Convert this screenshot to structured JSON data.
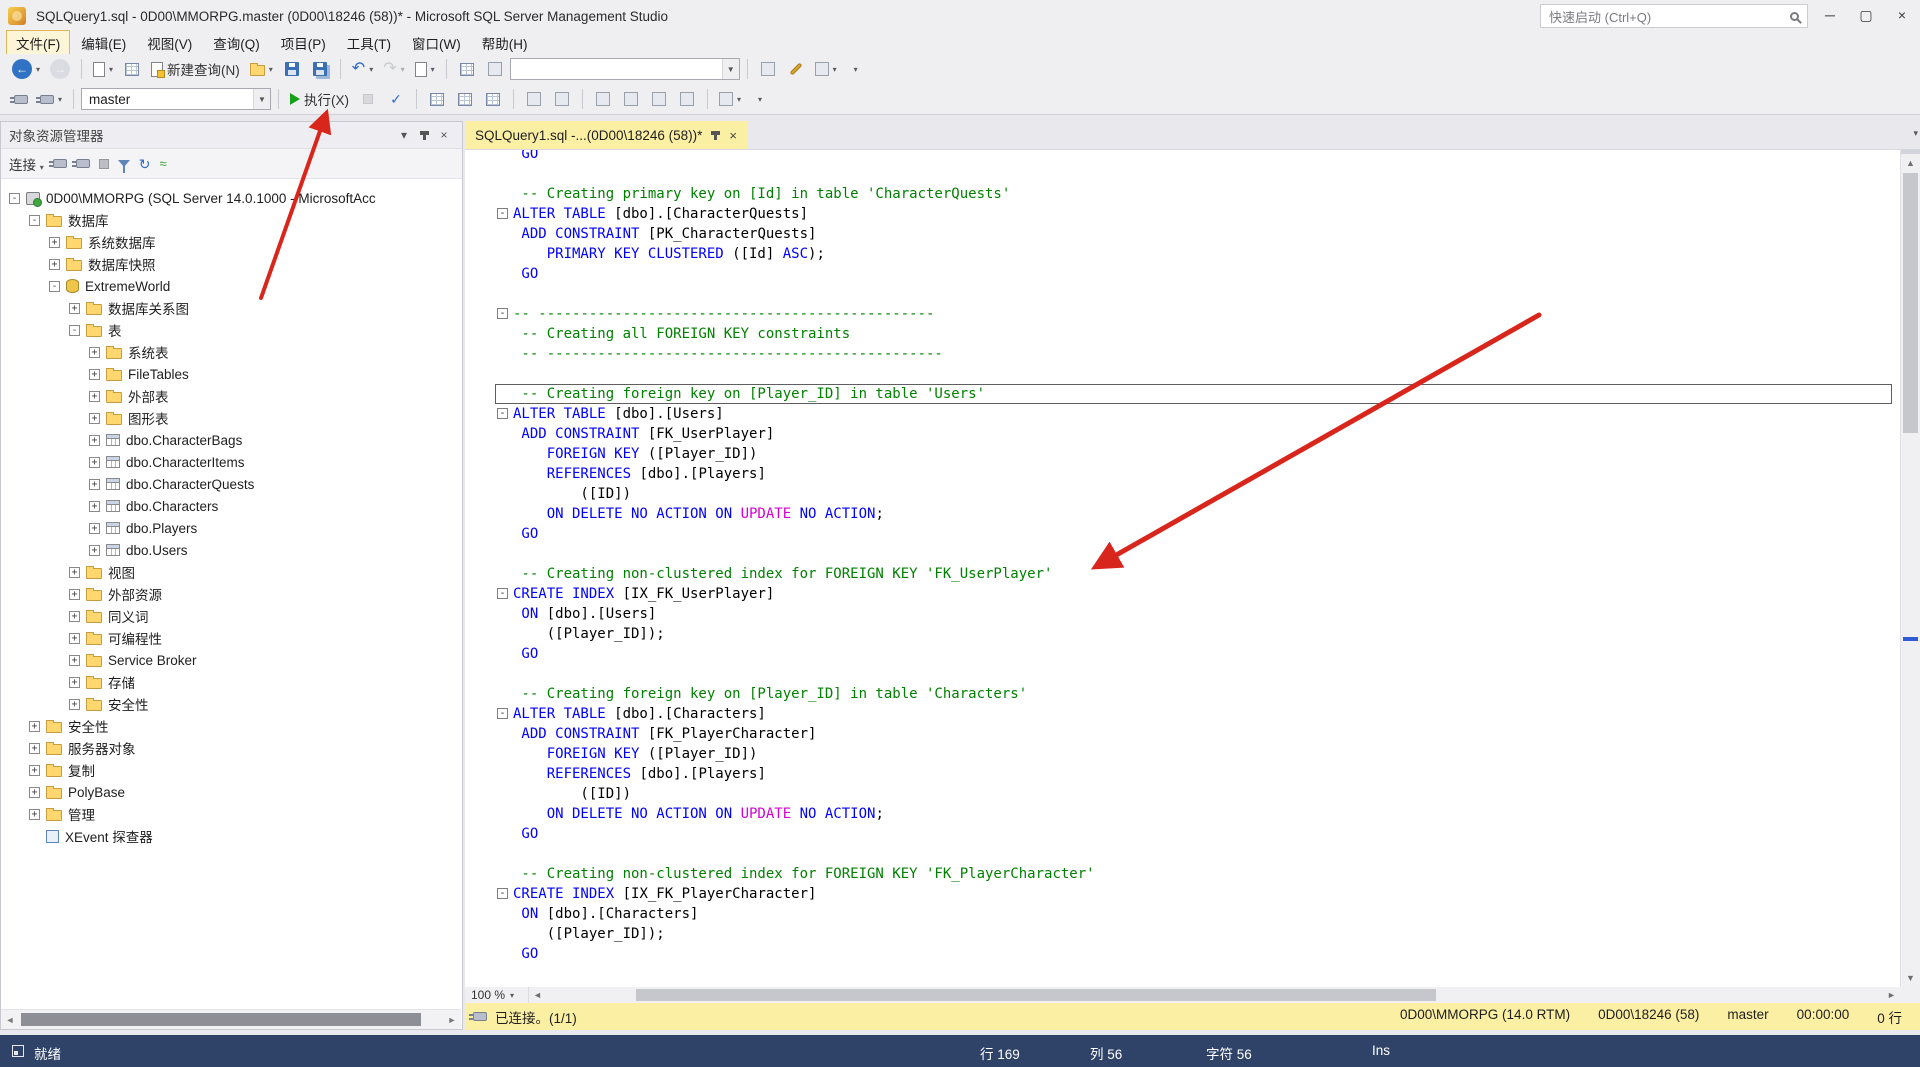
{
  "window": {
    "title": "SQLQuery1.sql - 0D00\\MMORPG.master (0D00\\18246 (58))* - Microsoft SQL Server Management Studio",
    "quick_launch": "快速启动 (Ctrl+Q)"
  },
  "menu": {
    "items": [
      "文件(F)",
      "编辑(E)",
      "视图(V)",
      "查询(Q)",
      "项目(P)",
      "工具(T)",
      "窗口(W)",
      "帮助(H)"
    ]
  },
  "toolbar": {
    "new_query_label": "新建查询(N)",
    "database_value": "master",
    "execute_label": "执行(X)"
  },
  "object_explorer": {
    "title": "对象资源管理器",
    "connect_label": "连接",
    "tree": [
      {
        "indent": 0,
        "exp": "collapse",
        "icon": "server",
        "label": "0D00\\MMORPG (SQL Server 14.0.1000 - MicrosoftAcc"
      },
      {
        "indent": 1,
        "exp": "collapse",
        "icon": "folder",
        "label": "数据库"
      },
      {
        "indent": 2,
        "exp": "expand",
        "icon": "folder",
        "label": "系统数据库"
      },
      {
        "indent": 2,
        "exp": "expand",
        "icon": "folder",
        "label": "数据库快照"
      },
      {
        "indent": 2,
        "exp": "collapse",
        "icon": "database",
        "label": "ExtremeWorld"
      },
      {
        "indent": 3,
        "exp": "expand",
        "icon": "folder",
        "label": "数据库关系图"
      },
      {
        "indent": 3,
        "exp": "collapse",
        "icon": "folder",
        "label": "表"
      },
      {
        "indent": 4,
        "exp": "expand",
        "icon": "folder",
        "label": "系统表"
      },
      {
        "indent": 4,
        "exp": "expand",
        "icon": "folder",
        "label": "FileTables"
      },
      {
        "indent": 4,
        "exp": "expand",
        "icon": "folder",
        "label": "外部表"
      },
      {
        "indent": 4,
        "exp": "expand",
        "icon": "folder",
        "label": "图形表"
      },
      {
        "indent": 4,
        "exp": "expand",
        "icon": "table",
        "label": "dbo.CharacterBags"
      },
      {
        "indent": 4,
        "exp": "expand",
        "icon": "table",
        "label": "dbo.CharacterItems"
      },
      {
        "indent": 4,
        "exp": "expand",
        "icon": "table",
        "label": "dbo.CharacterQuests"
      },
      {
        "indent": 4,
        "exp": "expand",
        "icon": "table",
        "label": "dbo.Characters"
      },
      {
        "indent": 4,
        "exp": "expand",
        "icon": "table",
        "label": "dbo.Players"
      },
      {
        "indent": 4,
        "exp": "expand",
        "icon": "table",
        "label": "dbo.Users"
      },
      {
        "indent": 3,
        "exp": "expand",
        "icon": "folder",
        "label": "视图"
      },
      {
        "indent": 3,
        "exp": "expand",
        "icon": "folder",
        "label": "外部资源"
      },
      {
        "indent": 3,
        "exp": "expand",
        "icon": "folder",
        "label": "同义词"
      },
      {
        "indent": 3,
        "exp": "expand",
        "icon": "folder",
        "label": "可编程性"
      },
      {
        "indent": 3,
        "exp": "expand",
        "icon": "folder",
        "label": "Service Broker"
      },
      {
        "indent": 3,
        "exp": "expand",
        "icon": "folder",
        "label": "存储"
      },
      {
        "indent": 3,
        "exp": "expand",
        "icon": "folder",
        "label": "安全性"
      },
      {
        "indent": 1,
        "exp": "expand",
        "icon": "folder",
        "label": "安全性"
      },
      {
        "indent": 1,
        "exp": "expand",
        "icon": "folder",
        "label": "服务器对象"
      },
      {
        "indent": 1,
        "exp": "expand",
        "icon": "folder",
        "label": "复制"
      },
      {
        "indent": 1,
        "exp": "expand",
        "icon": "folder",
        "label": "PolyBase"
      },
      {
        "indent": 1,
        "exp": "expand",
        "icon": "folder",
        "label": "管理"
      },
      {
        "indent": 1,
        "exp": "none",
        "icon": "xevent",
        "label": "XEvent 探查器"
      }
    ]
  },
  "editor": {
    "tab_title": "SQLQuery1.sql -...(0D00\\18246 (58))*",
    "zoom": "100 %",
    "lines": [
      {
        "s": [
          [
            "k",
            " GO"
          ]
        ]
      },
      {
        "s": []
      },
      {
        "s": [
          [
            "c",
            " -- Creating primary key on [Id] in table 'CharacterQuests'"
          ]
        ]
      },
      {
        "f": true,
        "s": [
          [
            "k",
            "ALTER TABLE"
          ],
          [
            "n",
            " [dbo].[CharacterQuests]"
          ]
        ]
      },
      {
        "s": [
          [
            "k",
            " ADD CONSTRAINT"
          ],
          [
            "n",
            " [PK_CharacterQuests]"
          ]
        ]
      },
      {
        "s": [
          [
            "k",
            "    PRIMARY KEY CLUSTERED"
          ],
          [
            "n",
            " ([Id] "
          ],
          [
            "k",
            "ASC"
          ],
          [
            "n",
            ");"
          ]
        ]
      },
      {
        "s": [
          [
            "k",
            " GO"
          ]
        ]
      },
      {
        "s": []
      },
      {
        "f": true,
        "s": [
          [
            "c",
            "-- -----------------------------------------------"
          ]
        ]
      },
      {
        "s": [
          [
            "c",
            " -- Creating all FOREIGN KEY constraints"
          ]
        ]
      },
      {
        "s": [
          [
            "c",
            " -- -----------------------------------------------"
          ]
        ]
      },
      {
        "s": []
      },
      {
        "cur": true,
        "s": [
          [
            "c",
            " -- Creating foreign key on [Player_ID] in table 'Users'"
          ]
        ]
      },
      {
        "f": true,
        "s": [
          [
            "k",
            "ALTER TABLE"
          ],
          [
            "n",
            " [dbo].[Users]"
          ]
        ]
      },
      {
        "s": [
          [
            "k",
            " ADD CONSTRAINT"
          ],
          [
            "n",
            " [FK_UserPlayer]"
          ]
        ]
      },
      {
        "s": [
          [
            "k",
            "    FOREIGN KEY"
          ],
          [
            "n",
            " ([Player_ID])"
          ]
        ]
      },
      {
        "s": [
          [
            "k",
            "    REFERENCES"
          ],
          [
            "n",
            " [dbo].[Players]"
          ]
        ]
      },
      {
        "s": [
          [
            "n",
            "        ([ID])"
          ]
        ]
      },
      {
        "s": [
          [
            "k",
            "    ON DELETE NO ACTION ON "
          ],
          [
            "m",
            "UPDATE"
          ],
          [
            "k",
            " NO ACTION"
          ],
          [
            "n",
            ";"
          ]
        ]
      },
      {
        "s": [
          [
            "k",
            " GO"
          ]
        ]
      },
      {
        "s": []
      },
      {
        "s": [
          [
            "c",
            " -- Creating non-clustered index for FOREIGN KEY 'FK_UserPlayer'"
          ]
        ]
      },
      {
        "f": true,
        "s": [
          [
            "k",
            "CREATE INDEX"
          ],
          [
            "n",
            " [IX_FK_UserPlayer]"
          ]
        ]
      },
      {
        "s": [
          [
            "k",
            " ON"
          ],
          [
            "n",
            " [dbo].[Users]"
          ]
        ]
      },
      {
        "s": [
          [
            "n",
            "    ([Player_ID]);"
          ]
        ]
      },
      {
        "s": [
          [
            "k",
            " GO"
          ]
        ]
      },
      {
        "s": []
      },
      {
        "s": [
          [
            "c",
            " -- Creating foreign key on [Player_ID] in table 'Characters'"
          ]
        ]
      },
      {
        "f": true,
        "s": [
          [
            "k",
            "ALTER TABLE"
          ],
          [
            "n",
            " [dbo].[Characters]"
          ]
        ]
      },
      {
        "s": [
          [
            "k",
            " ADD CONSTRAINT"
          ],
          [
            "n",
            " [FK_PlayerCharacter]"
          ]
        ]
      },
      {
        "s": [
          [
            "k",
            "    FOREIGN KEY"
          ],
          [
            "n",
            " ([Player_ID])"
          ]
        ]
      },
      {
        "s": [
          [
            "k",
            "    REFERENCES"
          ],
          [
            "n",
            " [dbo].[Players]"
          ]
        ]
      },
      {
        "s": [
          [
            "n",
            "        ([ID])"
          ]
        ]
      },
      {
        "s": [
          [
            "k",
            "    ON DELETE NO ACTION ON "
          ],
          [
            "m",
            "UPDATE"
          ],
          [
            "k",
            " NO ACTION"
          ],
          [
            "n",
            ";"
          ]
        ]
      },
      {
        "s": [
          [
            "k",
            " GO"
          ]
        ]
      },
      {
        "s": []
      },
      {
        "s": [
          [
            "c",
            " -- Creating non-clustered index for FOREIGN KEY 'FK_PlayerCharacter'"
          ]
        ]
      },
      {
        "f": true,
        "s": [
          [
            "k",
            "CREATE INDEX"
          ],
          [
            "n",
            " [IX_FK_PlayerCharacter]"
          ]
        ]
      },
      {
        "s": [
          [
            "k",
            " ON"
          ],
          [
            "n",
            " [dbo].[Characters]"
          ]
        ]
      },
      {
        "s": [
          [
            "n",
            "    ([Player_ID]);"
          ]
        ]
      },
      {
        "s": [
          [
            "k",
            " GO"
          ]
        ]
      }
    ]
  },
  "query_status": {
    "connection": "已连接。(1/1)",
    "server": "0D00\\MMORPG (14.0 RTM)",
    "login": "0D00\\18246 (58)",
    "database": "master",
    "time": "00:00:00",
    "rows": "0 行"
  },
  "status_bar": {
    "state": "就绪",
    "line": "行 169",
    "column": "列 56",
    "character": "字符 56",
    "insert_mode": "Ins"
  },
  "colors": {
    "keyword": "#0000FF",
    "comment": "#008000",
    "system": "#D600D6",
    "text": "#000000",
    "annotation_arrow": "#D9261C",
    "accent_yellow": "#FBEFA4"
  }
}
